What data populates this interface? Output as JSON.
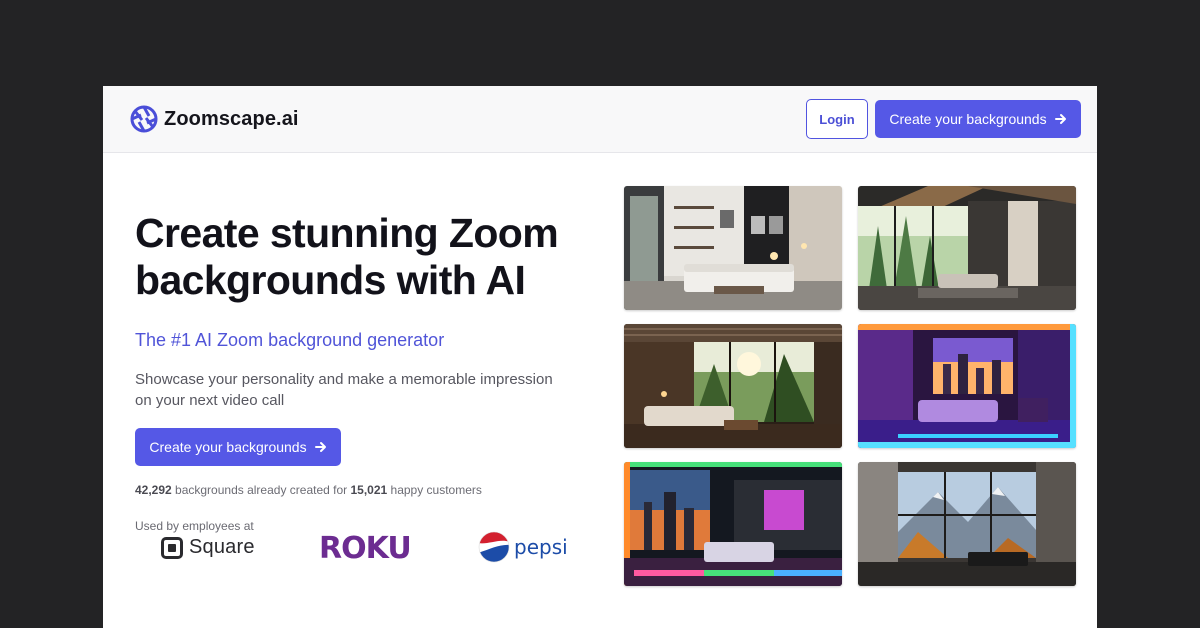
{
  "brand": {
    "name": "Zoomscape.ai",
    "logo_icon": "aperture-icon",
    "accent": "#5558e6"
  },
  "nav": {
    "login_label": "Login",
    "cta_label": "Create your backgrounds",
    "cta_icon": "arrow-right-icon"
  },
  "hero": {
    "headline_line1": "Create stunning Zoom",
    "headline_line2": "backgrounds with AI",
    "subheadline": "The #1 AI Zoom background generator",
    "description_line1": "Showcase your personality and make a memorable impression",
    "description_line2": "on your next video call",
    "cta_label": "Create your backgrounds",
    "stats": {
      "backgrounds_count": "42,292",
      "backgrounds_text": " backgrounds already created for ",
      "customers_count": "15,021",
      "customers_text": " happy customers"
    },
    "used_by_label": "Used by employees at"
  },
  "customer_logos": {
    "square": "Square",
    "roku": "ROKU",
    "pepsi": "pepsi"
  },
  "gallery": [
    {
      "theme": "modern-living-room"
    },
    {
      "theme": "a-frame-forest-loft"
    },
    {
      "theme": "jungle-view-lounge"
    },
    {
      "theme": "neon-purple-bedroom"
    },
    {
      "theme": "neon-city-bedroom"
    },
    {
      "theme": "mountain-view-room"
    }
  ]
}
